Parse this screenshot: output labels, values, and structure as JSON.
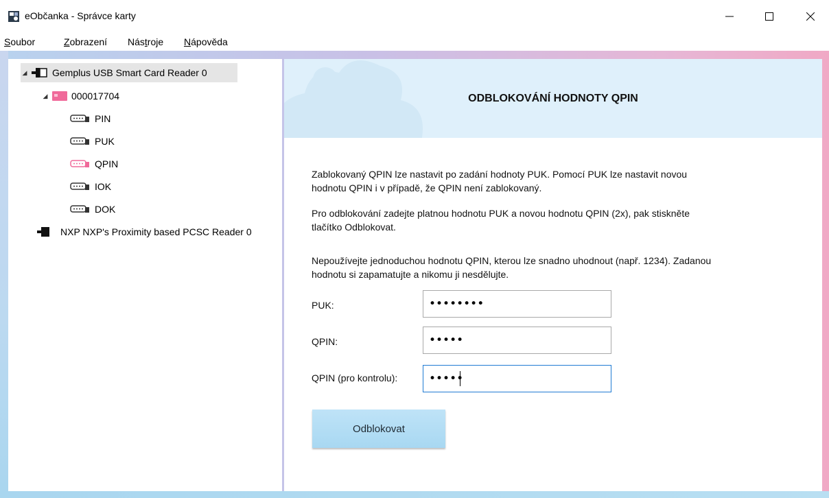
{
  "window": {
    "title": "eObčanka - Správce karty"
  },
  "menu": [
    {
      "pre": "",
      "u": "S",
      "post": "oubor"
    },
    {
      "pre": "",
      "u": "Z",
      "post": "obrazení"
    },
    {
      "pre": "Nás",
      "u": "t",
      "post": "roje"
    },
    {
      "pre": "",
      "u": "N",
      "post": "ápověda"
    }
  ],
  "tree": {
    "reader1": "Gemplus USB Smart Card Reader 0",
    "card": "000017704",
    "items": [
      "PIN",
      "PUK",
      "QPIN",
      "IOK",
      "DOK"
    ],
    "reader2": "NXP NXP's Proximity based PCSC Reader 0"
  },
  "colors": {
    "accent_pink": "#f06a9a",
    "accent_blue": "#1e7ad3",
    "header_band": "#dff0fb"
  },
  "main": {
    "title": "ODBLOKOVÁNÍ HODNOTY QPIN",
    "para1_line1": "Zablokovaný QPIN lze nastavit po zadání hodnoty PUK. Pomocí PUK lze nastavit novou",
    "para1_line2": "hodnotu QPIN i v případě, že QPIN není zablokovaný.",
    "para2_line1": "Pro odblokování zadejte platnou hodnotu PUK a novou hodnotu QPIN (2x), pak stiskněte",
    "para2_line2": "tlačítko Odblokovat.",
    "para3_line1": "Nepoužívejte jednoduchou hodnotu QPIN, kterou lze snadno uhodnout (např. 1234). Zadanou",
    "para3_line2": "hodnotu si zapamatujte a nikomu ji nesdělujte.",
    "puk_label": "PUK:",
    "puk_value": "••••••••",
    "qpin_label": "QPIN:",
    "qpin_value": "•••••",
    "qpin_confirm_label": "QPIN (pro kontrolu):",
    "qpin_confirm_value": "•••••",
    "button": "Odblokovat"
  }
}
